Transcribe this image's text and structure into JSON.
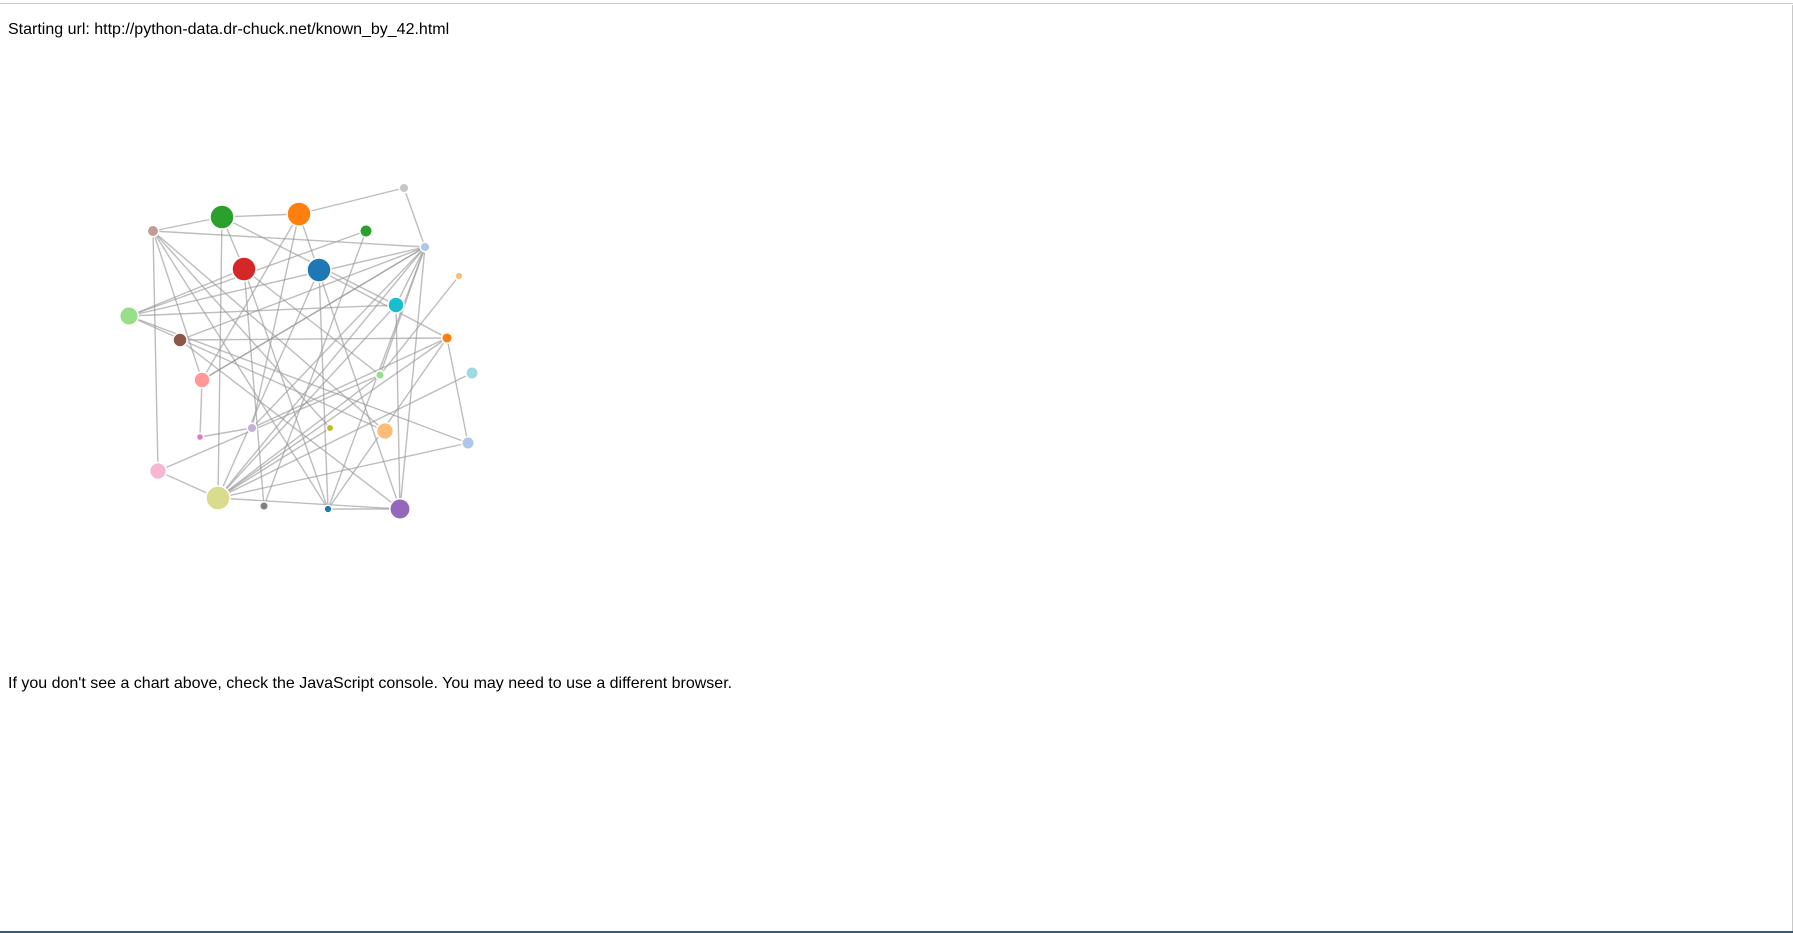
{
  "starting": {
    "label": "Starting url:",
    "url": "http://python-data.dr-chuck.net/known_by_42.html"
  },
  "footer_note": "If you don't see a chart above, check the JavaScript console. You may need to use a different browser.",
  "colors": {
    "edge": "#999999",
    "frame_bottom": "#2d5f7a"
  },
  "graph": {
    "nodes": [
      {
        "id": "n0",
        "color": "#2ca02c",
        "rank": 1.0
      },
      {
        "id": "n1",
        "color": "#ff7f0e",
        "rank": 1.0
      },
      {
        "id": "n2",
        "color": "#c7c7c7",
        "rank": 0.2
      },
      {
        "id": "n3",
        "color": "#c49c94",
        "rank": 0.3
      },
      {
        "id": "n4",
        "color": "#2ca02c",
        "rank": 0.35
      },
      {
        "id": "n5",
        "color": "#aec7e8",
        "rank": 0.2
      },
      {
        "id": "n6",
        "color": "#d62728",
        "rank": 1.0
      },
      {
        "id": "n7",
        "color": "#1f77b4",
        "rank": 1.0
      },
      {
        "id": "n8",
        "color": "#ffbb78",
        "rank": 0.1
      },
      {
        "id": "n9",
        "color": "#17becf",
        "rank": 0.55
      },
      {
        "id": "n10",
        "color": "#98df8a",
        "rank": 0.7
      },
      {
        "id": "n11",
        "color": "#8c564b",
        "rank": 0.45
      },
      {
        "id": "n12",
        "color": "#ff7f0e",
        "rank": 0.25
      },
      {
        "id": "n13",
        "color": "#9edae5",
        "rank": 0.35
      },
      {
        "id": "n14",
        "color": "#98df8a",
        "rank": 0.15
      },
      {
        "id": "n15",
        "color": "#ff9896",
        "rank": 0.55
      },
      {
        "id": "n16",
        "color": "#e377c2",
        "rank": 0.05
      },
      {
        "id": "n17",
        "color": "#c5b0d5",
        "rank": 0.2
      },
      {
        "id": "n18",
        "color": "#bcbd22",
        "rank": 0.08
      },
      {
        "id": "n19",
        "color": "#ffbb78",
        "rank": 0.6
      },
      {
        "id": "n20",
        "color": "#aec7e8",
        "rank": 0.35
      },
      {
        "id": "n21",
        "color": "#f7b6d2",
        "rank": 0.6
      },
      {
        "id": "n22",
        "color": "#dbdb8d",
        "rank": 1.0
      },
      {
        "id": "n23",
        "color": "#7f7f7f",
        "rank": 0.15
      },
      {
        "id": "n24",
        "color": "#1f77b4",
        "rank": 0.1
      },
      {
        "id": "n25",
        "color": "#9467bd",
        "rank": 0.8
      }
    ],
    "links": [
      [
        "n3",
        "n5"
      ],
      [
        "n3",
        "n0"
      ],
      [
        "n0",
        "n1"
      ],
      [
        "n1",
        "n2"
      ],
      [
        "n2",
        "n5"
      ],
      [
        "n3",
        "n21"
      ],
      [
        "n3",
        "n15"
      ],
      [
        "n3",
        "n24"
      ],
      [
        "n3",
        "n19"
      ],
      [
        "n3",
        "n18"
      ],
      [
        "n0",
        "n22"
      ],
      [
        "n0",
        "n9"
      ],
      [
        "n1",
        "n17"
      ],
      [
        "n1",
        "n25"
      ],
      [
        "n1",
        "n15"
      ],
      [
        "n4",
        "n10"
      ],
      [
        "n4",
        "n23"
      ],
      [
        "n6",
        "n24"
      ],
      [
        "n6",
        "n10"
      ],
      [
        "n6",
        "n14"
      ],
      [
        "n7",
        "n22"
      ],
      [
        "n7",
        "n24"
      ],
      [
        "n7",
        "n12"
      ],
      [
        "n10",
        "n5"
      ],
      [
        "n10",
        "n9"
      ],
      [
        "n10",
        "n19"
      ],
      [
        "n10",
        "n20"
      ],
      [
        "n11",
        "n5"
      ],
      [
        "n11",
        "n25"
      ],
      [
        "n11",
        "n12"
      ],
      [
        "n15",
        "n5"
      ],
      [
        "n15",
        "n16"
      ],
      [
        "n16",
        "n17"
      ],
      [
        "n5",
        "n22"
      ],
      [
        "n5",
        "n17"
      ],
      [
        "n5",
        "n25"
      ],
      [
        "n5",
        "n24"
      ],
      [
        "n5",
        "n14"
      ],
      [
        "n5",
        "n9"
      ],
      [
        "n5",
        "n15"
      ],
      [
        "n8",
        "n14"
      ],
      [
        "n9",
        "n22"
      ],
      [
        "n9",
        "n25"
      ],
      [
        "n12",
        "n22"
      ],
      [
        "n12",
        "n17"
      ],
      [
        "n12",
        "n24"
      ],
      [
        "n13",
        "n22"
      ],
      [
        "n14",
        "n22"
      ],
      [
        "n14",
        "n21"
      ],
      [
        "n18",
        "n22"
      ],
      [
        "n20",
        "n22"
      ],
      [
        "n20",
        "n12"
      ],
      [
        "n22",
        "n21"
      ],
      [
        "n22",
        "n25"
      ],
      [
        "n24",
        "n25"
      ],
      [
        "n0",
        "n6"
      ],
      [
        "n6",
        "n23"
      ]
    ]
  }
}
